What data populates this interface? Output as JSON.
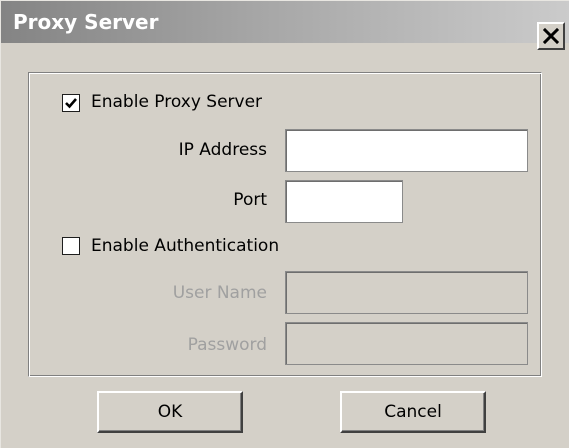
{
  "window": {
    "title": "Proxy Server",
    "close_icon": "close-icon"
  },
  "proxy": {
    "enable_label": "Enable Proxy Server",
    "enable_checked": true,
    "ip_label": "IP Address",
    "ip_value": "",
    "port_label": "Port",
    "port_value": ""
  },
  "auth": {
    "enable_label": "Enable Authentication",
    "enable_checked": false,
    "username_label": "User Name",
    "username_value": "",
    "password_label": "Password",
    "password_value": ""
  },
  "buttons": {
    "ok_label": "OK",
    "cancel_label": "Cancel"
  },
  "colors": {
    "dialog_background": "#d4d0c8",
    "disabled_text": "#a0a0a0"
  }
}
